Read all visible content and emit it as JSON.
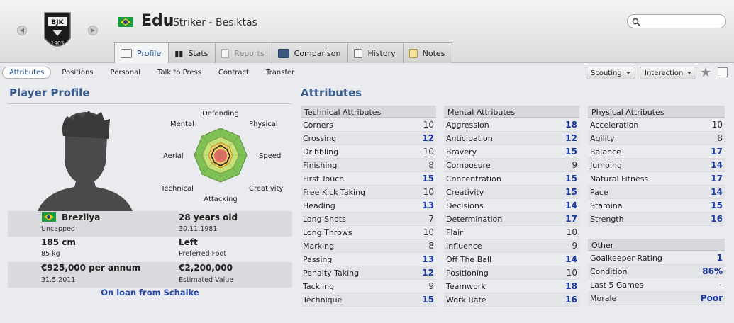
{
  "header": {
    "name": "Edu",
    "subtitle": "Striker - Besiktas",
    "crest_text_top": "BJK",
    "crest_text_bottom": "1903",
    "nav_prev_icon": "chevron-left-icon",
    "nav_next_icon": "chevron-right-icon",
    "search_placeholder": ""
  },
  "tabs": [
    {
      "label": "Profile",
      "icon": "profile-card-icon",
      "active": true
    },
    {
      "label": "Stats",
      "icon": "bar-chart-icon"
    },
    {
      "label": "Reports",
      "icon": "report-icon",
      "disabled": true
    },
    {
      "label": "Comparison",
      "icon": "comparison-icon"
    },
    {
      "label": "History",
      "icon": "history-icon"
    },
    {
      "label": "Notes",
      "icon": "notes-icon"
    }
  ],
  "subnav": [
    "Attributes",
    "Positions",
    "Personal",
    "Talk to Press",
    "Contract",
    "Transfer"
  ],
  "actions": {
    "scouting": "Scouting",
    "interaction": "Interaction"
  },
  "profile": {
    "title": "Player Profile",
    "radar_labels": {
      "defending": "Defending",
      "physical": "Physical",
      "speed": "Speed",
      "creativity": "Creativity",
      "attacking": "Attacking",
      "technical": "Technical",
      "aerial": "Aerial",
      "mental": "Mental"
    },
    "nationality": "Brezilya",
    "caps": "Uncapped",
    "age": "28 years old",
    "dob": "30.11.1981",
    "height": "185 cm",
    "weight": "85 kg",
    "foot": "Left",
    "foot_label": "Preferred Foot",
    "wage": "€925,000 per annum",
    "contract_end": "31.5.2011",
    "value": "€2,200,000",
    "value_label": "Estimated Value",
    "loan": "On loan from Schalke"
  },
  "attributes": {
    "title": "Attributes",
    "technical": {
      "heading": "Technical Attributes",
      "rows": [
        {
          "name": "Corners",
          "value": "10"
        },
        {
          "name": "Crossing",
          "value": "12"
        },
        {
          "name": "Dribbling",
          "value": "10"
        },
        {
          "name": "Finishing",
          "value": "8"
        },
        {
          "name": "First Touch",
          "value": "15"
        },
        {
          "name": "Free Kick Taking",
          "value": "10"
        },
        {
          "name": "Heading",
          "value": "13"
        },
        {
          "name": "Long Shots",
          "value": "7"
        },
        {
          "name": "Long Throws",
          "value": "10"
        },
        {
          "name": "Marking",
          "value": "8"
        },
        {
          "name": "Passing",
          "value": "13"
        },
        {
          "name": "Penalty Taking",
          "value": "12"
        },
        {
          "name": "Tackling",
          "value": "9"
        },
        {
          "name": "Technique",
          "value": "15"
        }
      ]
    },
    "mental": {
      "heading": "Mental Attributes",
      "rows": [
        {
          "name": "Aggression",
          "value": "18"
        },
        {
          "name": "Anticipation",
          "value": "12"
        },
        {
          "name": "Bravery",
          "value": "15"
        },
        {
          "name": "Composure",
          "value": "9"
        },
        {
          "name": "Concentration",
          "value": "15"
        },
        {
          "name": "Creativity",
          "value": "15"
        },
        {
          "name": "Decisions",
          "value": "14"
        },
        {
          "name": "Determination",
          "value": "17"
        },
        {
          "name": "Flair",
          "value": "10"
        },
        {
          "name": "Influence",
          "value": "9"
        },
        {
          "name": "Off The Ball",
          "value": "14"
        },
        {
          "name": "Positioning",
          "value": "10"
        },
        {
          "name": "Teamwork",
          "value": "18"
        },
        {
          "name": "Work Rate",
          "value": "16"
        }
      ]
    },
    "physical": {
      "heading": "Physical Attributes",
      "rows": [
        {
          "name": "Acceleration",
          "value": "10"
        },
        {
          "name": "Agility",
          "value": "8"
        },
        {
          "name": "Balance",
          "value": "17"
        },
        {
          "name": "Jumping",
          "value": "14"
        },
        {
          "name": "Natural Fitness",
          "value": "17"
        },
        {
          "name": "Pace",
          "value": "14"
        },
        {
          "name": "Stamina",
          "value": "15"
        },
        {
          "name": "Strength",
          "value": "16"
        }
      ]
    },
    "other": {
      "heading": "Other",
      "rows": [
        {
          "name": "Goalkeeper Rating",
          "value": "1"
        },
        {
          "name": "Condition",
          "value": "86%"
        },
        {
          "name": "Last 5 Games",
          "value": "-"
        },
        {
          "name": "Morale",
          "value": "Poor"
        }
      ]
    }
  }
}
